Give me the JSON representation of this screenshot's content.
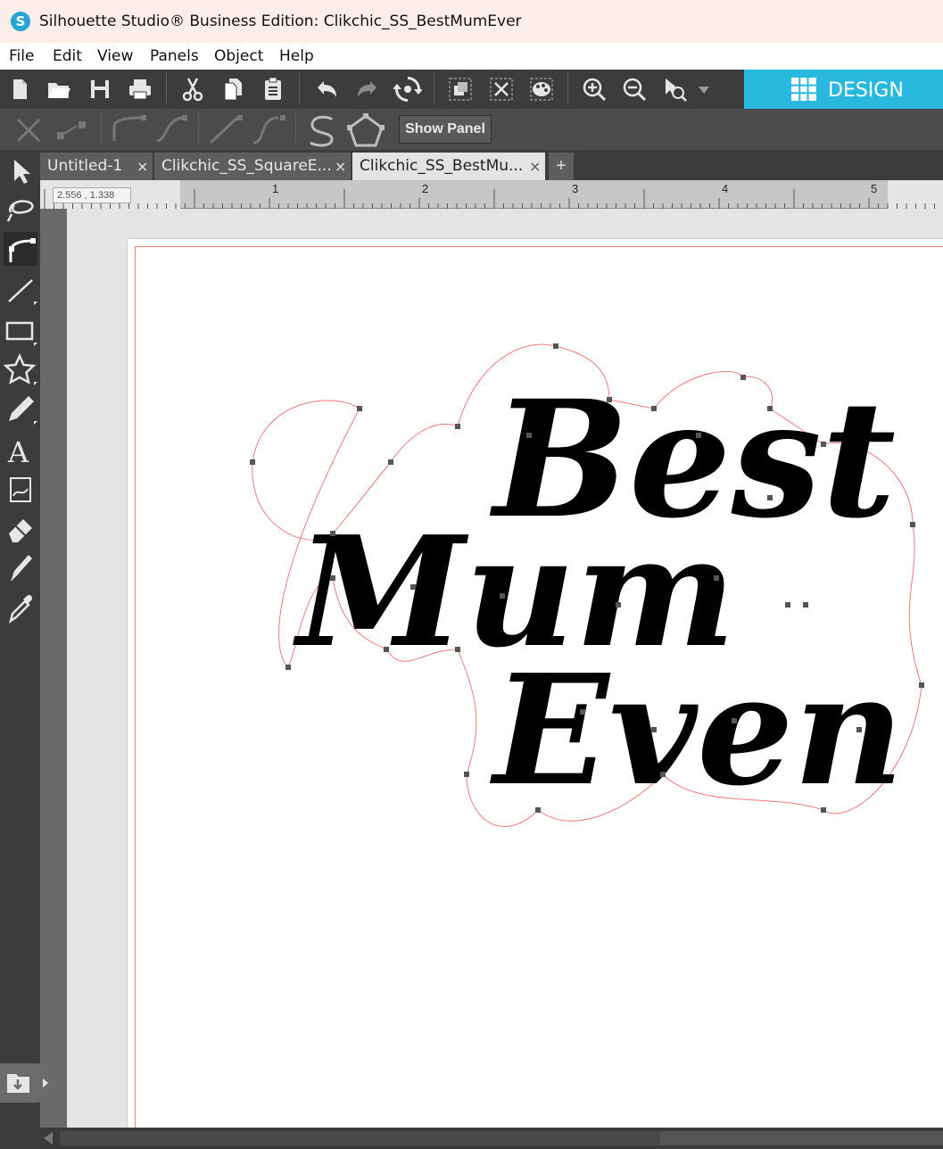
{
  "window": {
    "title": "Silhouette Studio® Business Edition: Clikchic_SS_BestMumEver",
    "logo_letter": "S"
  },
  "menu": [
    "File",
    "Edit",
    "View",
    "Panels",
    "Object",
    "Help"
  ],
  "toolbar": {
    "icons": [
      "new-file-icon",
      "open-folder-icon",
      "save-icon",
      "print-icon",
      "cut-icon",
      "copy-icon",
      "paste-icon",
      "undo-icon",
      "redo-icon",
      "redraw-icon",
      "group-icon",
      "ungroup-icon",
      "palette-icon",
      "zoom-in-icon",
      "zoom-out-icon",
      "zoom-select-icon"
    ],
    "design_label": "DESIGN"
  },
  "toolbar2": {
    "show_panel": "Show Panel"
  },
  "tabs": [
    {
      "label": "Untitled-1",
      "close": "×",
      "active": false
    },
    {
      "label": "Clikchic_SS_SquareE...",
      "close": "×",
      "active": false
    },
    {
      "label": "Clikchic_SS_BestMu...",
      "close": "×",
      "active": true
    }
  ],
  "tab_add": "+",
  "ruler": {
    "coords": "2.556 , 1.338",
    "numbers": [
      "1",
      "2",
      "3",
      "4",
      "5"
    ]
  },
  "artwork": {
    "lines": [
      "Best",
      "Mum",
      "Even"
    ]
  },
  "colors": {
    "accent": "#29b9df",
    "cut_line": "#f08080"
  }
}
